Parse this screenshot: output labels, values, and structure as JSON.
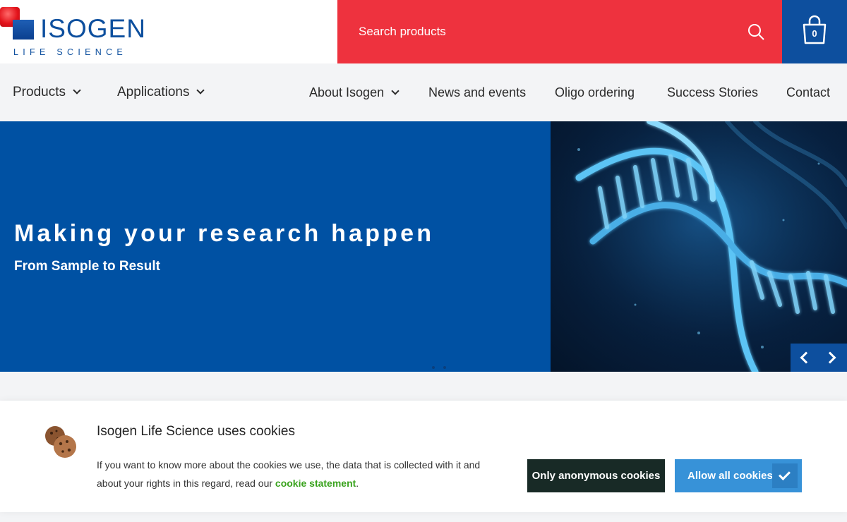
{
  "logo": {
    "title": "ISOGEN",
    "subtitle": "LIFE SCIENCE"
  },
  "search": {
    "placeholder": "Search products"
  },
  "cart": {
    "count": "0"
  },
  "nav": {
    "products": "Products",
    "applications": "Applications",
    "about": "About Isogen",
    "news": "News and events",
    "oligo": "Oligo ordering",
    "success": "Success Stories",
    "contact": "Contact"
  },
  "hero": {
    "title": "Making your research happen",
    "subtitle": "From Sample to Result"
  },
  "cookie": {
    "title": "Isogen Life Science uses cookies",
    "text_before": "If you want to know more about the cookies we use, the data that is collected with it and about your rights in this regard, read our ",
    "link": "cookie statement",
    "text_after": ".",
    "anon_button": "Only anonymous cookies",
    "allow_button": "Allow all cookies"
  },
  "colors": {
    "brand_blue": "#0d4f9e",
    "hero_blue": "#0051a3",
    "search_red": "#ee323e",
    "link_green": "#3aa31e",
    "allow_blue": "#3792d8",
    "anon_dark": "#182a26"
  }
}
